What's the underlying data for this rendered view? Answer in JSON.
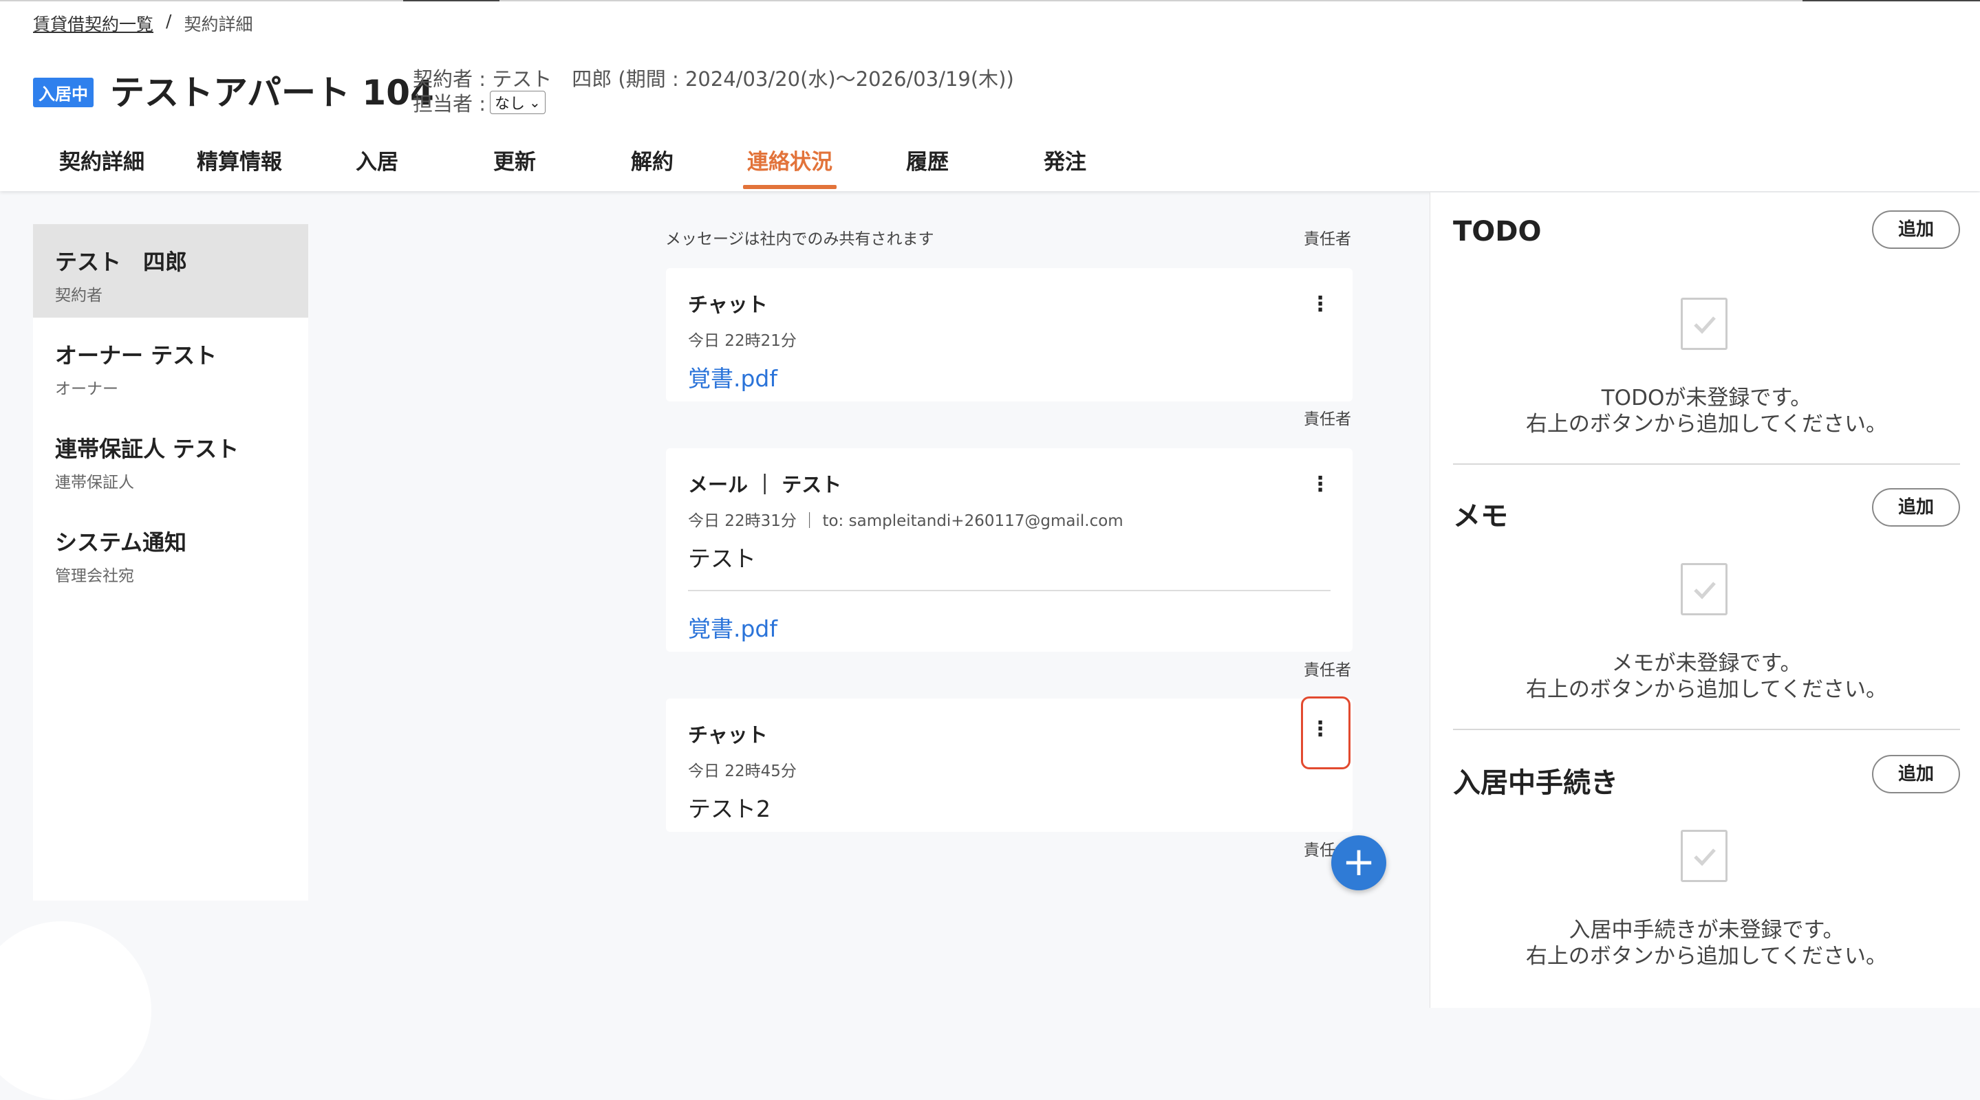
{
  "breadcrumb": {
    "parent": "賃貸借契約一覧",
    "separator": "/",
    "current": "契約詳細"
  },
  "header": {
    "status_badge": "入居中",
    "title": "テストアパート 104",
    "contract_info": "契約者 : テスト　四郎 (期間 : 2024/03/20(水)〜2026/03/19(木))",
    "assignee_label": "担当者 :",
    "assignee_value": "なし",
    "assignee_chevron": "⌄"
  },
  "tabs": [
    {
      "label": "契約詳細"
    },
    {
      "label": "精算情報"
    },
    {
      "label": "入居"
    },
    {
      "label": "更新"
    },
    {
      "label": "解約"
    },
    {
      "label": "連絡状況",
      "active": true
    },
    {
      "label": "履歴"
    },
    {
      "label": "発注"
    }
  ],
  "contacts": [
    {
      "name": "テスト　四郎",
      "role": "契約者",
      "selected": true
    },
    {
      "name": "オーナー テスト",
      "role": "オーナー"
    },
    {
      "name": "連帯保証人 テスト",
      "role": "連帯保証人"
    },
    {
      "name": "システム通知",
      "role": "管理会社宛"
    }
  ],
  "messages": {
    "note": "メッセージは社内でのみ共有されます",
    "responsible_label": "責任者",
    "responsible_label_partial": "責任",
    "kebab_glyph": "⋮",
    "items": [
      {
        "title": "チャット",
        "time": "今日 22時21分",
        "link": "覚書.pdf"
      },
      {
        "title": "メール ｜ テスト",
        "time": "今日 22時31分 ｜ to: sampleitandi+260117@gmail.com",
        "body": "テスト",
        "link": "覚書.pdf"
      },
      {
        "title": "チャット",
        "time": "今日 22時45分",
        "body": "テスト2"
      }
    ]
  },
  "fab": {
    "glyph": "+"
  },
  "right_panel": {
    "add_label": "追加",
    "sections": [
      {
        "title": "TODO",
        "empty_line1": "TODOが未登録です。",
        "empty_line2": "右上のボタンから追加してください。"
      },
      {
        "title": "メモ",
        "empty_line1": "メモが未登録です。",
        "empty_line2": "右上のボタンから追加してください。"
      },
      {
        "title": "入居中手続き",
        "empty_line1": "入居中手続きが未登録です。",
        "empty_line2": "右上のボタンから追加してください。"
      }
    ]
  },
  "colors": {
    "accent_tab": "#e2733a",
    "badge": "#2f80ed",
    "link": "#2a73d9",
    "fab": "#2f7bd6",
    "highlight": "#e24a2f"
  }
}
